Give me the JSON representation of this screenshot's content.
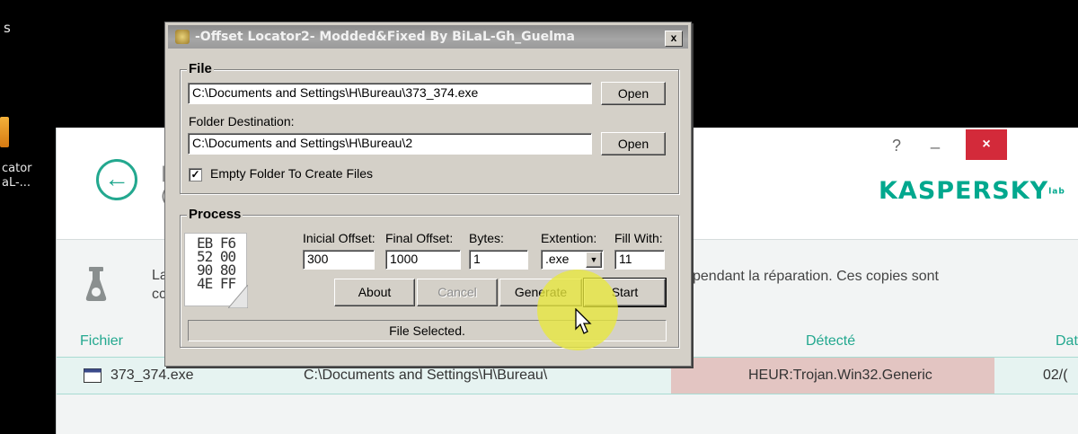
{
  "desktop": {
    "label_top": "s",
    "icon_label_1": "cator",
    "icon_label_2": "aL-..."
  },
  "kaspersky": {
    "back_icon": "arrow-left-icon",
    "back_glyph": "←",
    "help_label": "?",
    "minimize_label": "_",
    "close_label": "×",
    "logo": "KASPERSKY",
    "logo_lab": "lab",
    "info_partial_1": "La",
    "info_partial_2": "cc",
    "info_text": "pendant la réparation. Ces copies sont",
    "columns": {
      "file": "Fichier",
      "detected": "Détecté",
      "date": "Dat"
    },
    "row": {
      "file": "373_374.exe",
      "path": "C:\\Documents and Settings\\H\\Bureau\\",
      "detected": "HEUR:Trojan.Win32.Generic",
      "date": "02/("
    },
    "colors": {
      "accent": "#23a88f",
      "danger": "#d32a3a"
    }
  },
  "dialog": {
    "title": "-Offset Locator2- Modded&Fixed By BiLaL-Gh_Guelma",
    "close_label": "x",
    "file_group": {
      "title": "File",
      "file_path": "C:\\Documents and Settings\\H\\Bureau\\373_374.exe",
      "open_label": "Open",
      "folder_label": "Folder Destination:",
      "folder_path": "C:\\Documents and Settings\\H\\Bureau\\2",
      "open2_label": "Open",
      "checkbox_label": "Empty Folder To Create Files",
      "checkbox_checked": true
    },
    "process_group": {
      "title": "Process",
      "hex_art": "EB F6\n52 00\n90 80\n4E FF",
      "initial_offset_label": "Inicial Offset:",
      "final_offset_label": "Final Offset:",
      "bytes_label": "Bytes:",
      "extension_label": "Extention:",
      "fill_label": "Fill With:",
      "initial_offset": "300",
      "final_offset": "1000",
      "bytes": "1",
      "extension": ".exe",
      "fill": "11",
      "about_label": "About",
      "cancel_label": "Cancel",
      "generate_label": "Generate",
      "start_label": "Start"
    },
    "status": "File Selected."
  }
}
